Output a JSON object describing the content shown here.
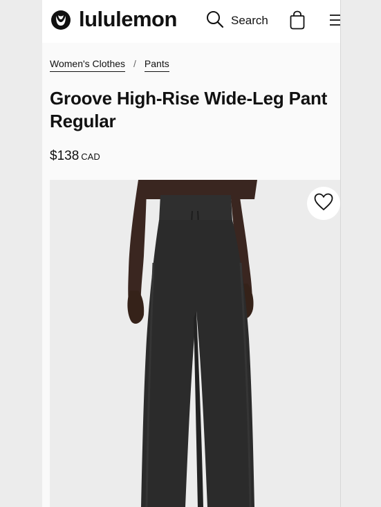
{
  "header": {
    "brand": "lululemon",
    "search_label": "Search"
  },
  "breadcrumb": {
    "items": [
      "Women's Clothes",
      "Pants"
    ],
    "separator": "/"
  },
  "product": {
    "title": "Groove High-Rise Wide-Leg Pant Regular",
    "price_amount": "$138",
    "price_currency": "CAD",
    "image": "model wearing black high-rise wide-leg pants",
    "wishlist_icon": "heart-icon"
  },
  "colors": {
    "text": "#111111",
    "page_bg": "#fafafa",
    "image_bg": "#ececec",
    "pant": "#2b2b2b"
  }
}
